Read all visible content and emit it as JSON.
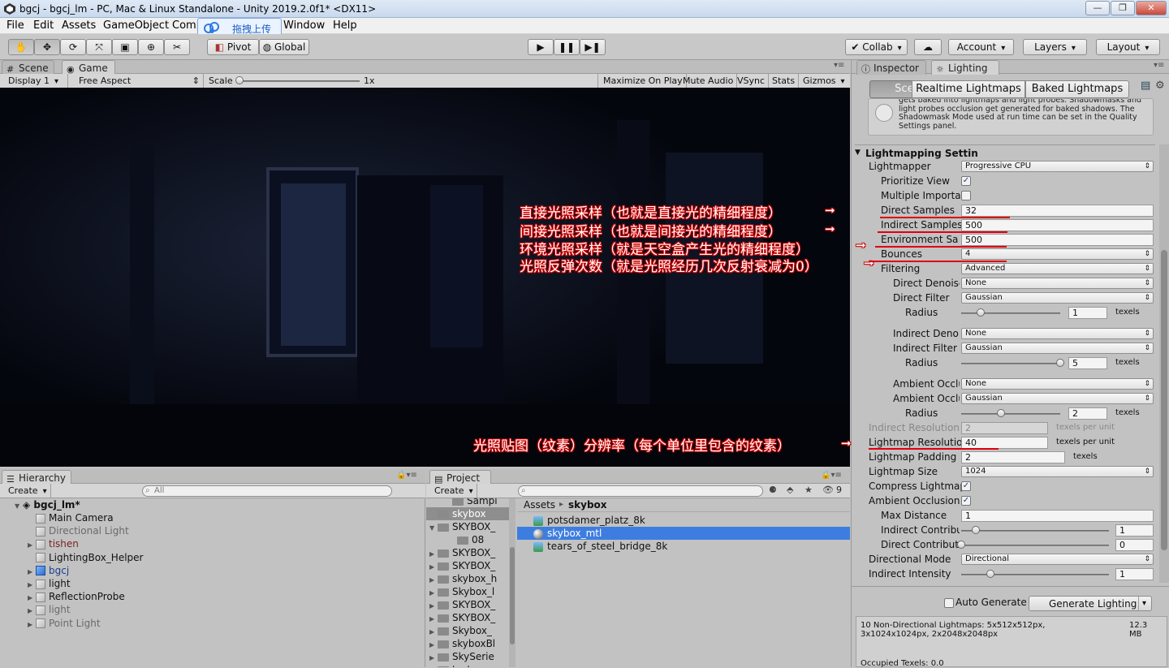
{
  "window": {
    "title": "bgcj - bgcj_lm - PC, Mac & Linux Standalone - Unity 2019.2.0f1* <DX11>",
    "controls": [
      "—",
      "❐",
      "✕"
    ]
  },
  "menu": [
    "File",
    "Edit",
    "Assets",
    "GameObject",
    "Comp",
    "Window",
    "Help"
  ],
  "baidu_popup": {
    "label": "拖拽上传"
  },
  "toolbar": {
    "pivot": "Pivot",
    "global": "Global",
    "collab": "Collab",
    "account": "Account",
    "layers": "Layers",
    "layout": "Layout"
  },
  "scene_tabs": {
    "scene": "Scene",
    "game": "Game"
  },
  "game_bar": {
    "display": "Display 1",
    "aspect": "Free Aspect",
    "scale_label": "Scale",
    "scale_value": "1x",
    "maximize": "Maximize On Play",
    "mute": "Mute Audio",
    "vsync": "VSync",
    "stats": "Stats",
    "gizmos": "Gizmos"
  },
  "hierarchy": {
    "tab": "Hierarchy",
    "create": "Create",
    "search_placeholder": "All",
    "scene_name": "bgcj_lm*",
    "items": [
      {
        "label": "Main Camera",
        "color": "#111111"
      },
      {
        "label": "Directional Light",
        "color": "#6a6a6a"
      },
      {
        "label": "tishen",
        "color": "#7a1f1f"
      },
      {
        "label": "LightingBox_Helper",
        "color": "#111111"
      },
      {
        "label": "bgcj",
        "color": "#1b3e8f"
      },
      {
        "label": "light",
        "color": "#111111"
      },
      {
        "label": "ReflectionProbe",
        "color": "#111111"
      },
      {
        "label": "light",
        "color": "#6a6a6a"
      },
      {
        "label": "Point Light",
        "color": "#6a6a6a"
      }
    ]
  },
  "project": {
    "tab": "Project",
    "create": "Create",
    "badge": "9",
    "breadcrumb": {
      "root": "Assets",
      "current": "skybox"
    },
    "tree": [
      "Sampl",
      "skybox",
      "SKYBOX_",
      "08",
      "SKYBOX_",
      "SKYBOX_",
      "skybox_h",
      "Skybox_l",
      "SKYBOX_",
      "SKYBOX_",
      "Skybox_",
      "skyboxBl",
      "SkySerie",
      "test"
    ],
    "assets": [
      "potsdamer_platz_8k",
      "skybox_mtl",
      "tears_of_steel_bridge_8k"
    ]
  },
  "right_tabs": {
    "inspector": "Inspector",
    "lighting": "Lighting"
  },
  "lighting": {
    "tabs": [
      "Scene",
      "Realtime Lightmaps",
      "Baked Lightmaps"
    ],
    "help_text": [
      "gets baked into lightmaps and light probes. Shadowmasks and",
      "light probes occlusion get generated for baked shadows. The",
      "Shadowmask Mode used at run time can be set in the Quality",
      "Settings panel."
    ],
    "section_title": "Lightmapping Settin",
    "fields": {
      "lightmapper": {
        "label": "Lightmapper",
        "value": "Progressive CPU"
      },
      "prioritize_view": {
        "label": "Prioritize View",
        "checked": true
      },
      "multiple_importance": {
        "label": "Multiple Importan",
        "checked": false
      },
      "direct_samples": {
        "label": "Direct Samples",
        "value": "32"
      },
      "indirect_samples": {
        "label": "Indirect Samples",
        "value": "500"
      },
      "environment_samples": {
        "label": "Environment Sam",
        "value": "500"
      },
      "bounces": {
        "label": "Bounces",
        "value": "4"
      },
      "filtering": {
        "label": "Filtering",
        "value": "Advanced"
      },
      "direct_denoiser": {
        "label": "Direct Denoise",
        "value": "None"
      },
      "direct_filter": {
        "label": "Direct Filter",
        "value": "Gaussian"
      },
      "direct_radius": {
        "label": "Radius",
        "value": "1",
        "unit": "texels",
        "fraction": 0.2
      },
      "indirect_denoiser": {
        "label": "Indirect Denoi",
        "value": "None"
      },
      "indirect_filter": {
        "label": "Indirect Filter",
        "value": "Gaussian"
      },
      "indirect_radius": {
        "label": "Radius",
        "value": "5",
        "unit": "texels",
        "fraction": 1.0
      },
      "ambient_denoiser": {
        "label": "Ambient Occlu",
        "value": "None"
      },
      "ambient_filter": {
        "label": "Ambient Occlu",
        "value": "Gaussian"
      },
      "ambient_radius": {
        "label": "Radius",
        "value": "2",
        "unit": "texels",
        "fraction": 0.4
      },
      "indirect_resolution": {
        "label": "Indirect Resolution",
        "value": "2",
        "unit": "texels per unit"
      },
      "lightmap_resolution": {
        "label": "Lightmap Resolution",
        "value": "40",
        "unit": "texels per unit"
      },
      "lightmap_padding": {
        "label": "Lightmap Padding",
        "value": "2",
        "unit": "texels"
      },
      "lightmap_size": {
        "label": "Lightmap Size",
        "value": "1024"
      },
      "compress": {
        "label": "Compress Lightmap",
        "checked": true
      },
      "ambient_occlusion": {
        "label": "Ambient Occlusion",
        "checked": true
      },
      "max_distance": {
        "label": "Max Distance",
        "value": "1"
      },
      "indirect_contribution": {
        "label": "Indirect Contribut",
        "value": "1",
        "fraction": 0.1
      },
      "direct_contribution": {
        "label": "Direct Contributio",
        "value": "0",
        "fraction": 0.0
      },
      "directional_mode": {
        "label": "Directional Mode",
        "value": "Directional"
      },
      "indirect_intensity": {
        "label": "Indirect Intensity",
        "value": "1",
        "fraction": 0.2
      }
    },
    "auto_generate": {
      "label": "Auto Generate",
      "checked": false
    },
    "generate_button": "Generate Lighting",
    "stats": {
      "line1": "10 Non-Directional Lightmaps: 5x512x512px,",
      "line2": "3x1024x1024px, 2x2048x2048px",
      "size": "12.3",
      "size_unit": "MB",
      "occupied": "Occupied Texels: 0.0"
    }
  },
  "annotations": [
    "直接光照采样（也就是直接光的精细程度）",
    "间接光照采样（也就是间接光的精细程度）",
    "环境光照采样（就是天空盒产生光的精细程度）",
    "光照反弹次数（就是光照经历几次反射衰减为0）",
    "光照贴图（纹素）分辨率（每个单位里包含的纹素）"
  ]
}
